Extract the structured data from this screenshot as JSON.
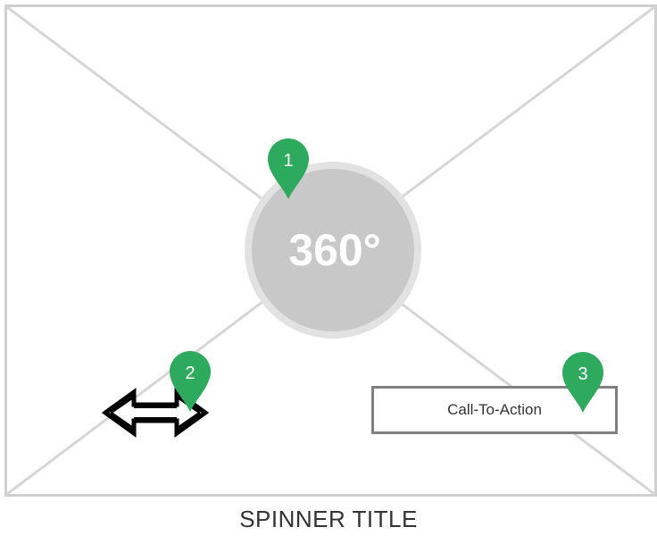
{
  "spinner": {
    "badge_label": "360°",
    "title": "SPINNER TITLE",
    "cta_label": "Call-To-Action",
    "drag_icon": "left-right-arrow-icon"
  },
  "markers": [
    {
      "number": "1",
      "target": "360-badge"
    },
    {
      "number": "2",
      "target": "drag-arrows"
    },
    {
      "number": "3",
      "target": "call-to-action-button"
    }
  ],
  "colors": {
    "marker": "#2eaa5e",
    "badge_fill": "#c8c8c8",
    "badge_ring": "#e2e2e2",
    "placeholder_lines": "#d6d6d6",
    "frame_border": "#d0d0d0",
    "cta_border": "#808080",
    "arrow": "#000000"
  }
}
